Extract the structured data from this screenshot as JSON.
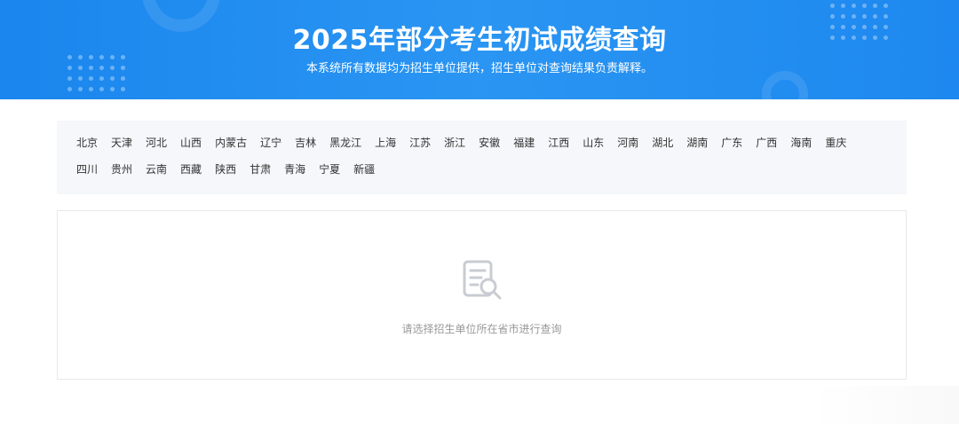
{
  "header": {
    "title": "2025年部分考生初试成绩查询",
    "subtitle": "本系统所有数据均为招生单位提供，招生单位对查询结果负责解释。"
  },
  "provinces": [
    "北京",
    "天津",
    "河北",
    "山西",
    "内蒙古",
    "辽宁",
    "吉林",
    "黑龙江",
    "上海",
    "江苏",
    "浙江",
    "安徽",
    "福建",
    "江西",
    "山东",
    "河南",
    "湖北",
    "湖南",
    "广东",
    "广西",
    "海南",
    "重庆",
    "四川",
    "贵州",
    "云南",
    "西藏",
    "陕西",
    "甘肃",
    "青海",
    "宁夏",
    "新疆"
  ],
  "result": {
    "icon": "document-search-icon",
    "empty_text": "请选择招生单位所在省市进行查询"
  },
  "colors": {
    "banner": "#1a86ee",
    "panel_bg": "#f5f7fa",
    "text": "#333333",
    "muted": "#999999"
  }
}
